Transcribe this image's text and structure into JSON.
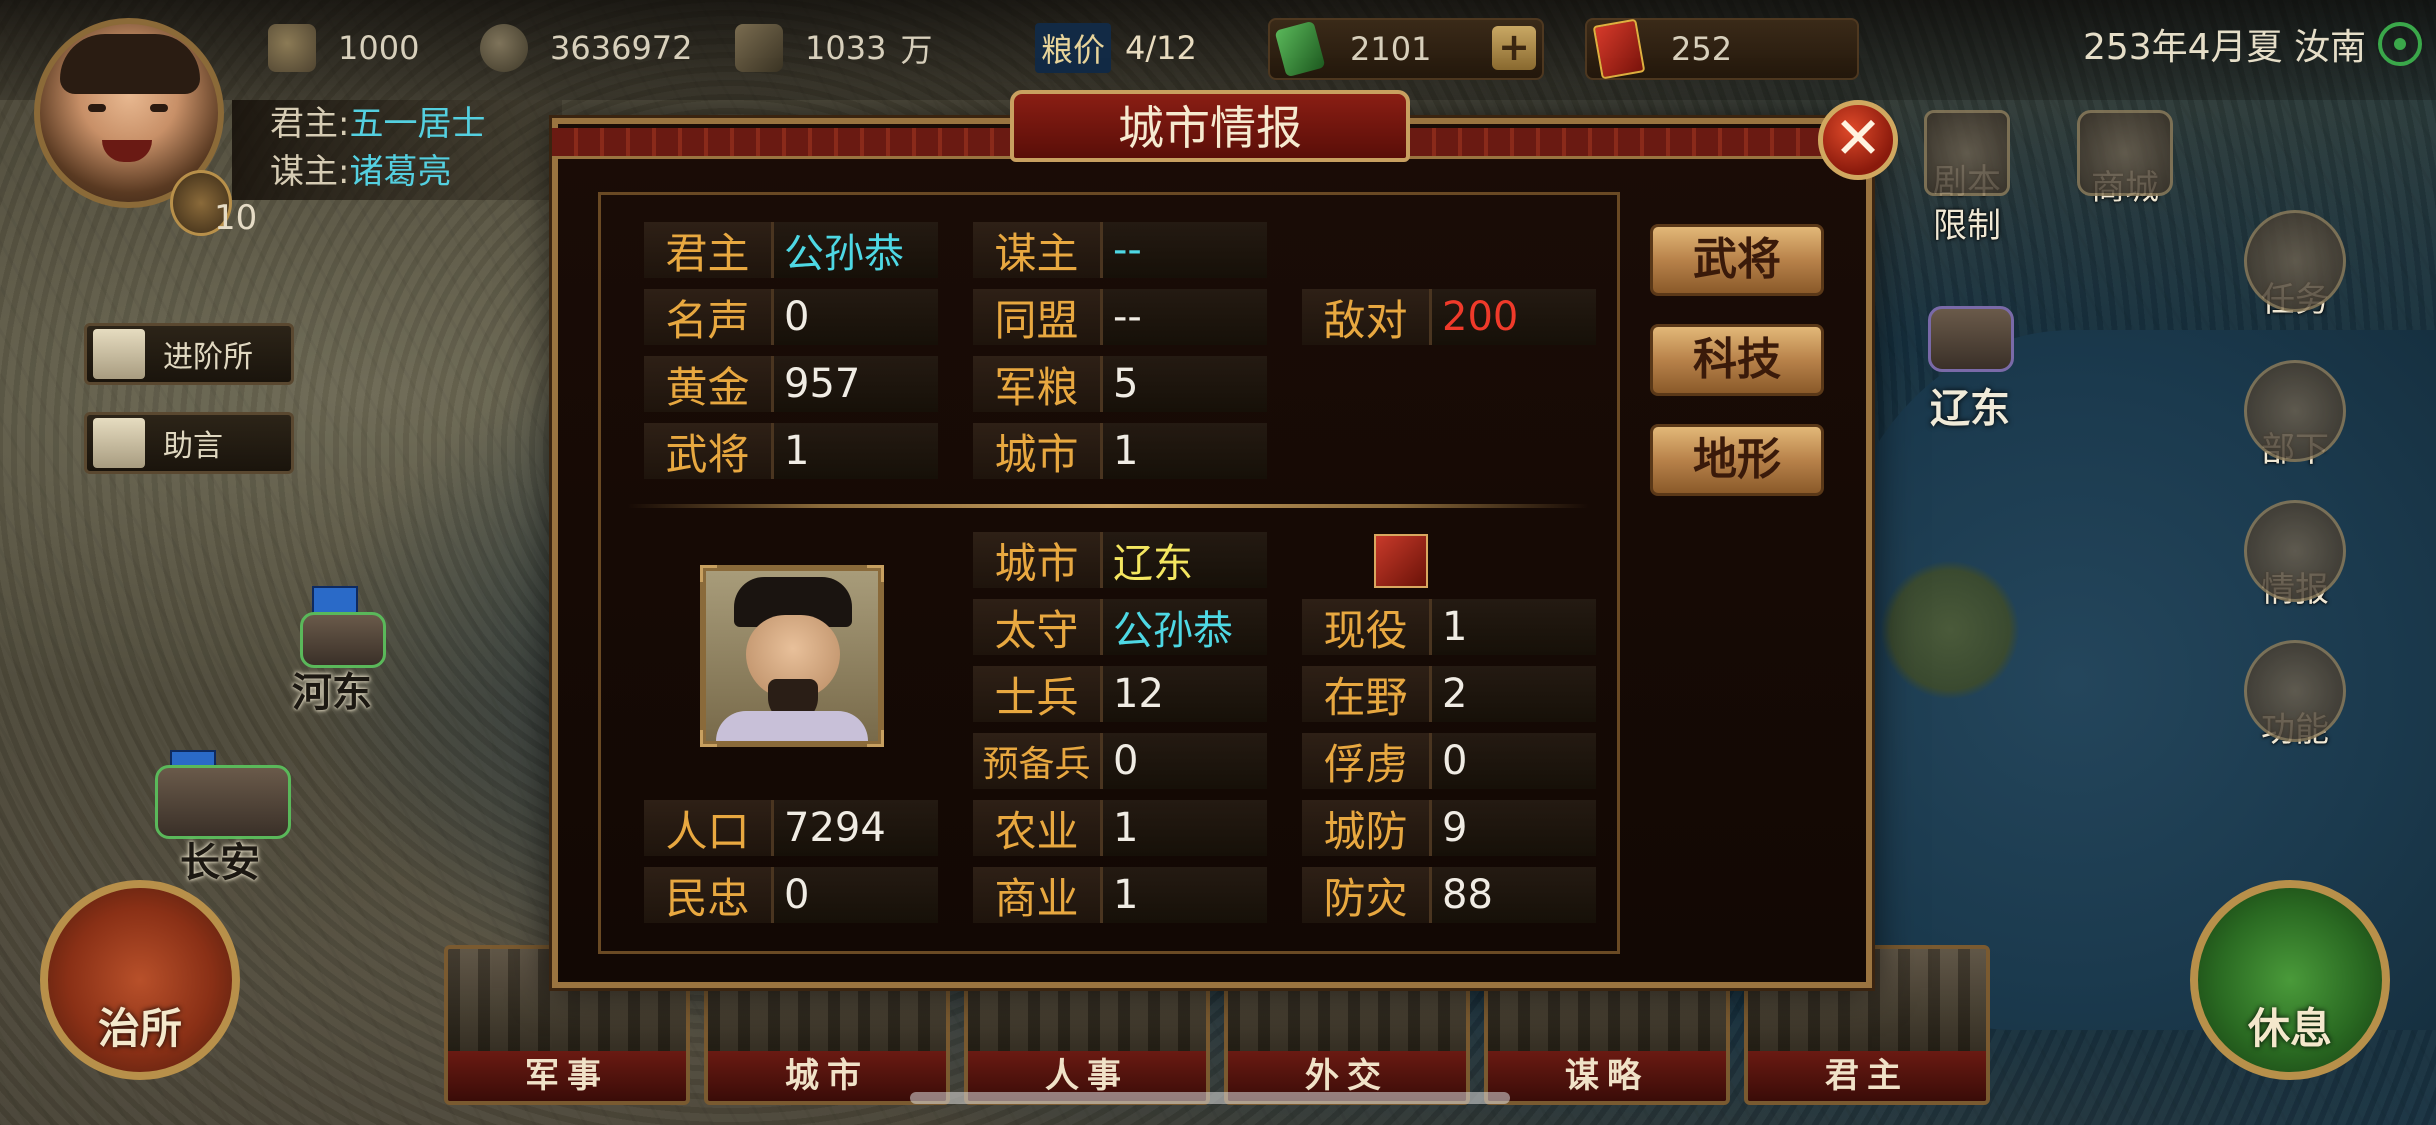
{
  "topbar": {
    "res1": {
      "icon": "gold-bar-icon",
      "value": "1000"
    },
    "res2": {
      "icon": "coin-icon",
      "value": "3636972"
    },
    "res3": {
      "icon": "grain-icon",
      "value": "1033",
      "unit": "万"
    },
    "price_label": "粮价",
    "price_value": "4/12",
    "jade": {
      "icon": "jade-icon",
      "value": "2101",
      "plus": "+"
    },
    "ticket": {
      "icon": "ticket-icon",
      "value": "252"
    },
    "date_location": "253年4月夏 汝南"
  },
  "player": {
    "ruler_label": "君主:",
    "ruler_name": "五一居士",
    "strategist_label": "谋主:",
    "strategist_name": "诸葛亮",
    "level": "10"
  },
  "left_buttons": {
    "advance": "进阶所",
    "advice": "助言"
  },
  "map_cities": {
    "hedong": "河东",
    "changan": "长安",
    "liaodong": "辽东"
  },
  "right_menu": {
    "script_limit": "剧本\n限制",
    "shop": "商城",
    "task": "任务",
    "subordinates": "部下",
    "intel": "情报",
    "functions": "功能"
  },
  "bottom_tabs": [
    "军事",
    "城市",
    "人事",
    "外交",
    "谋略",
    "君主"
  ],
  "round_buttons": {
    "office": "治所",
    "rest": "休息"
  },
  "dialog": {
    "title": "城市情报",
    "close": "✕",
    "faction": {
      "ruler": {
        "k": "君主",
        "v": "公孙恭"
      },
      "strategist": {
        "k": "谋主",
        "v": "--"
      },
      "fame": {
        "k": "名声",
        "v": "0"
      },
      "alliance": {
        "k": "同盟",
        "v": "--"
      },
      "hostility": {
        "k": "敌对",
        "v": "200"
      },
      "gold": {
        "k": "黄金",
        "v": "957"
      },
      "food": {
        "k": "军粮",
        "v": "5"
      },
      "generals": {
        "k": "武将",
        "v": "1"
      },
      "cities": {
        "k": "城市",
        "v": "1"
      }
    },
    "side_buttons": {
      "generals": "武将",
      "tech": "科技",
      "terrain": "地形"
    },
    "city": {
      "city": {
        "k": "城市",
        "v": "辽东"
      },
      "governor": {
        "k": "太守",
        "v": "公孙恭"
      },
      "soldiers": {
        "k": "士兵",
        "v": "12"
      },
      "reserve": {
        "k": "预备兵",
        "v": "0"
      },
      "agriculture": {
        "k": "农业",
        "v": "1"
      },
      "commerce": {
        "k": "商业",
        "v": "1"
      },
      "population": {
        "k": "人口",
        "v": "7294"
      },
      "loyalty": {
        "k": "民忠",
        "v": "0"
      },
      "active": {
        "k": "现役",
        "v": "1"
      },
      "unemployed": {
        "k": "在野",
        "v": "2"
      },
      "captives": {
        "k": "俘虏",
        "v": "0"
      },
      "defense": {
        "k": "城防",
        "v": "9"
      },
      "disaster": {
        "k": "防灾",
        "v": "88"
      }
    }
  },
  "colors": {
    "accent_gold": "#e8a840",
    "cyan": "#4ed8e4",
    "red": "#f03a2a",
    "yellow": "#f4e660"
  }
}
